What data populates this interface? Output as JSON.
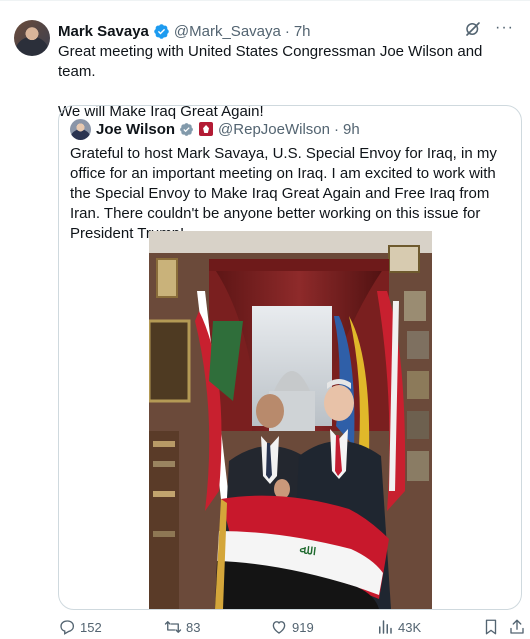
{
  "post": {
    "author_name": "Mark Savaya",
    "author_handle": "@Mark_Savaya",
    "separator": "·",
    "time": "7h",
    "text_line1": "Great meeting with United States Congressman Joe Wilson and team.",
    "text_line2": "We will Make Iraq Great Again!",
    "more_label": "···"
  },
  "quote": {
    "author_name": "Joe Wilson",
    "author_handle": "@RepJoeWilson",
    "separator": "·",
    "time": "9h",
    "text": "Grateful to host Mark Savaya, U.S. Special Envoy for Iraq, in my office for an important meeting on Iraq. I am excited to work with the Special Envoy to Make Iraq Great Again and Free Iraq from Iran. There couldn't be anyone better working on this issue for President Trump!"
  },
  "actions": {
    "replies": "152",
    "reposts": "83",
    "likes": "919",
    "views": "43K"
  },
  "icons": {
    "verified": "verified-badge-icon",
    "grok": "grok-icon",
    "more": "more-icon",
    "reply": "reply-icon",
    "repost": "repost-icon",
    "like": "like-icon",
    "views": "views-icon",
    "bookmark": "bookmark-icon",
    "share": "share-icon",
    "flag": "government-flag-icon"
  },
  "colors": {
    "text": "#0f1419",
    "secondary": "#536471",
    "border": "#cfd9de",
    "verified": "#1d9bf0"
  }
}
